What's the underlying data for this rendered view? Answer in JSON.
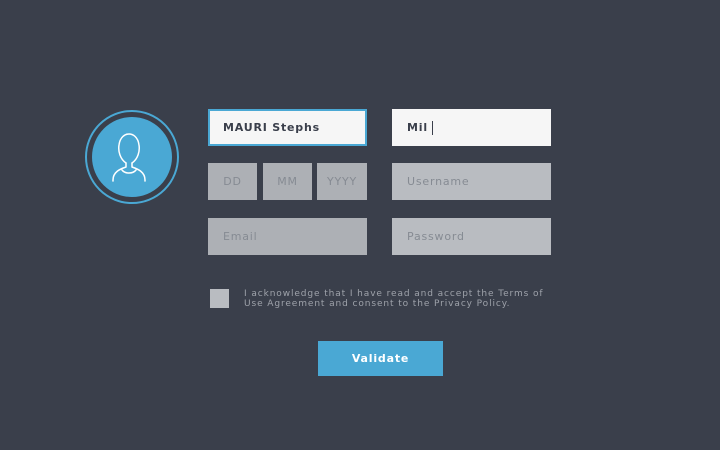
{
  "form": {
    "first_name_value": "MAURI Stephs",
    "last_name_value": "Mil",
    "day_placeholder": "DD",
    "month_placeholder": "MM",
    "year_placeholder": "YYYY",
    "username_placeholder": "Username",
    "email_placeholder": "Email",
    "password_placeholder": "Password",
    "terms_text": "I acknowledge that I have read and accept the Terms of Use Agreement and consent to the Privacy Policy.",
    "terms_checked": false,
    "validate_label": "Validate"
  },
  "avatar": {
    "icon": "user-icon"
  },
  "colors": {
    "background": "#3a3f4b",
    "accent": "#4aa8d4",
    "input_bg": "#b9bcc1",
    "input_active_bg": "#f6f6f6",
    "muted_text": "#9ea2aa"
  }
}
